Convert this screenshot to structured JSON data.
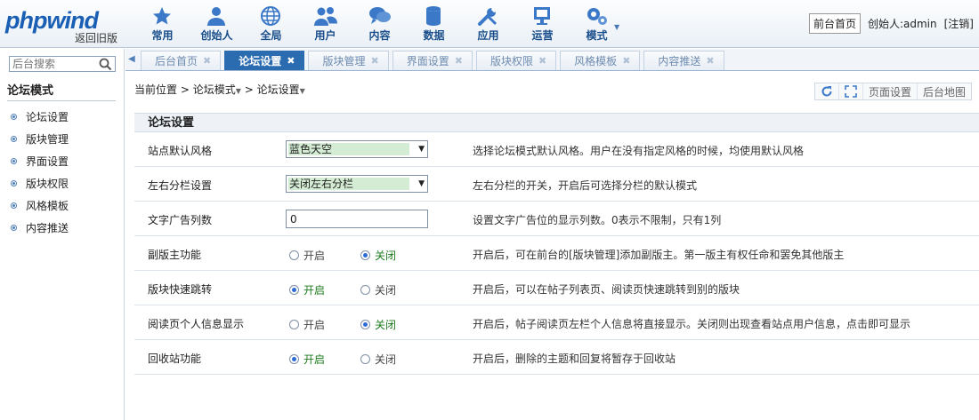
{
  "header": {
    "logo_text": "phpwind",
    "back_old": "返回旧版",
    "nav": [
      {
        "label": "常用",
        "icon": "star-icon"
      },
      {
        "label": "创始人",
        "icon": "person-icon"
      },
      {
        "label": "全局",
        "icon": "globe-icon"
      },
      {
        "label": "用户",
        "icon": "users-icon"
      },
      {
        "label": "内容",
        "icon": "chat-icon"
      },
      {
        "label": "数据",
        "icon": "database-icon"
      },
      {
        "label": "应用",
        "icon": "wrench-icon"
      },
      {
        "label": "运营",
        "icon": "monitor-icon"
      },
      {
        "label": "模式",
        "icon": "gears-icon"
      }
    ],
    "home_button": "前台首页",
    "creator": "创始人:admin",
    "logout": "[注销]"
  },
  "sidebar": {
    "search_placeholder": "后台搜索",
    "title": "论坛模式",
    "items": [
      "论坛设置",
      "版块管理",
      "界面设置",
      "版块权限",
      "风格模板",
      "内容推送"
    ]
  },
  "tabs": [
    {
      "label": "后台首页",
      "active": false
    },
    {
      "label": "论坛设置",
      "active": true
    },
    {
      "label": "版块管理",
      "active": false
    },
    {
      "label": "界面设置",
      "active": false
    },
    {
      "label": "版块权限",
      "active": false
    },
    {
      "label": "风格模板",
      "active": false
    },
    {
      "label": "内容推送",
      "active": false
    }
  ],
  "breadcrumb": {
    "root": "当前位置",
    "level1": "论坛模式",
    "level2": "论坛设置"
  },
  "tools": {
    "page_settings": "页面设置",
    "site_map": "后台地图"
  },
  "panel": {
    "title": "论坛设置",
    "rows": [
      {
        "label": "站点默认风格",
        "control": "select",
        "value": "蓝色天空",
        "desc": "选择论坛模式默认风格。用户在没有指定风格的时候，均使用默认风格"
      },
      {
        "label": "左右分栏设置",
        "control": "select",
        "value": "关闭左右分栏",
        "desc": "左右分栏的开关，开启后可选择分栏的默认模式"
      },
      {
        "label": "文字广告列数",
        "control": "input",
        "value": "0",
        "desc": "设置文字广告位的显示列数。0表示不限制，只有1列"
      },
      {
        "label": "副版主功能",
        "control": "radio",
        "on_label": "开启",
        "off_label": "关闭",
        "selected": "off",
        "desc": "开启后，可在前台的[版块管理]添加副版主。第一版主有权任命和罢免其他版主"
      },
      {
        "label": "版块快速跳转",
        "control": "radio",
        "on_label": "开启",
        "off_label": "关闭",
        "selected": "on",
        "desc": "开启后，可以在帖子列表页、阅读页快速跳转到别的版块"
      },
      {
        "label": "阅读页个人信息显示",
        "control": "radio",
        "on_label": "开启",
        "off_label": "关闭",
        "selected": "off",
        "desc": "开启后，帖子阅读页左栏个人信息将直接显示。关闭则出现查看站点用户信息，点击即可显示"
      },
      {
        "label": "回收站功能",
        "control": "radio",
        "on_label": "开启",
        "off_label": "关闭",
        "selected": "on",
        "desc": "开启后，删除的主题和回复将暂存于回收站"
      }
    ]
  },
  "colors": {
    "accent": "#2b6cb0",
    "nav_text": "#1a4f8c",
    "selected_green": "#1d7a1d"
  }
}
